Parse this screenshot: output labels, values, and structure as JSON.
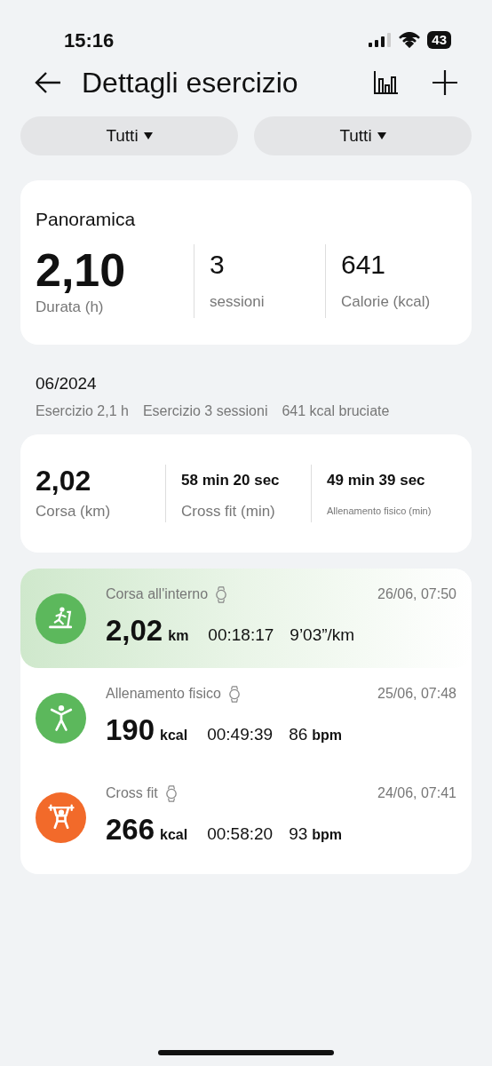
{
  "status_bar": {
    "time": "15:16",
    "battery": "43"
  },
  "header": {
    "title": "Dettagli esercizio"
  },
  "filters": [
    {
      "label": "Tutti"
    },
    {
      "label": "Tutti"
    }
  ],
  "overview": {
    "title": "Panoramica",
    "stats": [
      {
        "value": "2,10",
        "label": "Durata (h)"
      },
      {
        "value": "3",
        "label": "sessioni"
      },
      {
        "value": "641",
        "label": "Calorie (kcal)"
      }
    ]
  },
  "month": {
    "title": "06/2024",
    "summary": [
      "Esercizio 2,1 h",
      "Esercizio 3 sessioni",
      "641 kcal bruciate"
    ]
  },
  "totals": [
    {
      "value": "2,02",
      "label": "Corsa (km)"
    },
    {
      "value": "58 min 20 sec",
      "label": "Cross fit (min)"
    },
    {
      "value": "49 min 39 sec",
      "label": "Allenamento fisico (min)"
    }
  ],
  "activities": [
    {
      "kind": "treadmill",
      "color": "#5cb85c",
      "selected": true,
      "name": "Corsa all'interno",
      "date": "26/06, 07:50",
      "value": "2,02",
      "unit": "km",
      "duration": "00:18:17",
      "rate": "9’03”/km"
    },
    {
      "kind": "jumping",
      "color": "#5cb85c",
      "selected": false,
      "name": "Allenamento fisico",
      "date": "25/06, 07:48",
      "value": "190",
      "unit": "kcal",
      "duration": "00:49:39",
      "rate": "86",
      "rate_unit": "bpm"
    },
    {
      "kind": "weightlifting",
      "color": "#f26a2a",
      "selected": false,
      "name": "Cross fit",
      "date": "24/06, 07:41",
      "value": "266",
      "unit": "kcal",
      "duration": "00:58:20",
      "rate": "93",
      "rate_unit": "bpm"
    }
  ]
}
